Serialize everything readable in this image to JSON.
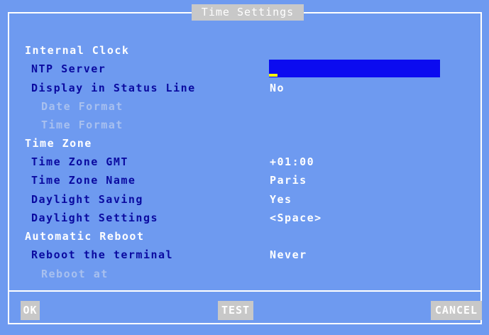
{
  "window": {
    "title": "Time Settings"
  },
  "sections": {
    "internal_clock": "Internal Clock",
    "time_zone": "Time Zone",
    "automatic_reboot": "Automatic Reboot"
  },
  "fields": {
    "ntp_server": {
      "label": "NTP Server",
      "value": ""
    },
    "display_status": {
      "label": "Display in Status Line",
      "value": "No"
    },
    "date_format": {
      "label": "Date Format"
    },
    "time_format": {
      "label": "Time Format"
    },
    "tz_gmt": {
      "label": "Time Zone GMT",
      "value": "+01:00"
    },
    "tz_name": {
      "label": "Time Zone Name",
      "value": "Paris"
    },
    "daylight_saving": {
      "label": "Daylight Saving",
      "value": "Yes"
    },
    "daylight_settings": {
      "label": "Daylight Settings",
      "value": "<Space>"
    },
    "reboot_terminal": {
      "label": "Reboot the terminal",
      "value": "Never"
    },
    "reboot_at": {
      "label": "Reboot at"
    }
  },
  "buttons": {
    "ok": "OK",
    "test": "TEST",
    "cancel": "CANCEL"
  },
  "colors": {
    "background": "#6e9af0",
    "section_text": "#ffffff",
    "label_text": "#0a0aa0",
    "disabled_text": "#a8c0ef",
    "input_fill": "#0b0bf0",
    "cursor": "#ffff00",
    "button_fill": "#c8c8c8"
  }
}
